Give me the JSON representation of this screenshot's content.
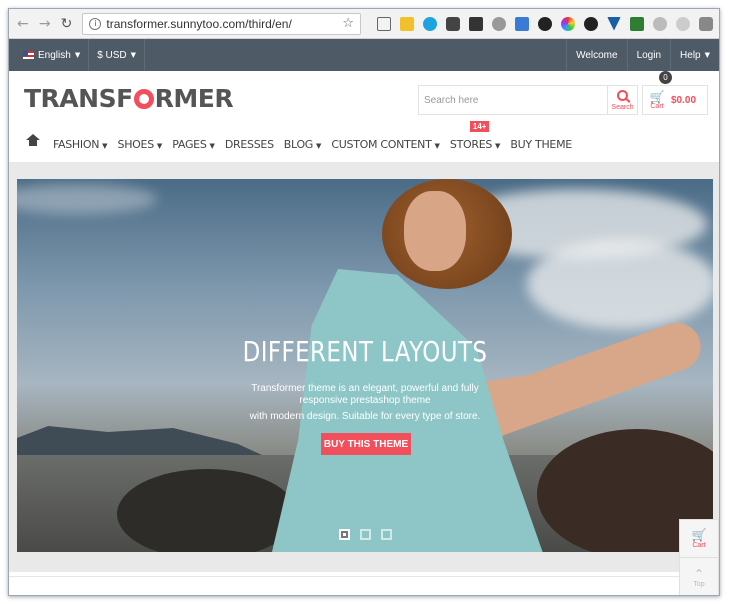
{
  "browser": {
    "url": "transformer.sunnytoo.com/third/en/"
  },
  "topbar": {
    "language": "English",
    "currency": "$ USD",
    "welcome": "Welcome",
    "login": "Login",
    "help": "Help"
  },
  "header": {
    "logo": {
      "before": "TRANSF",
      "after": "RMER"
    },
    "search_placeholder": "Search here",
    "search_label": "Search",
    "cart_label": "Cart",
    "cart_count": "0",
    "cart_total": "$0.00"
  },
  "nav": {
    "items": [
      {
        "label": "FASHION",
        "caret": true
      },
      {
        "label": "SHOES",
        "caret": true
      },
      {
        "label": "PAGES",
        "caret": true
      },
      {
        "label": "DRESSES",
        "caret": false
      },
      {
        "label": "BLOG",
        "caret": true
      },
      {
        "label": "CUSTOM CONTENT",
        "caret": true
      },
      {
        "label": "STORES",
        "caret": true,
        "badge": "14+"
      },
      {
        "label": "BUY THEME",
        "caret": false
      }
    ]
  },
  "hero": {
    "title": "DIFFERENT LAYOUTS",
    "text_line1": "Transformer theme is an elegant, powerful and fully",
    "text_line2": "responsive prestashop theme",
    "text_line3": "with modern design. Suitable for every type of store.",
    "button": "BUY THIS THEME",
    "slides": 3,
    "active_slide": 1
  },
  "side_tools": {
    "cart": "Cart",
    "top": "Top"
  },
  "colors": {
    "accent": "#f14f5c",
    "topbar": "#4e5a65"
  }
}
